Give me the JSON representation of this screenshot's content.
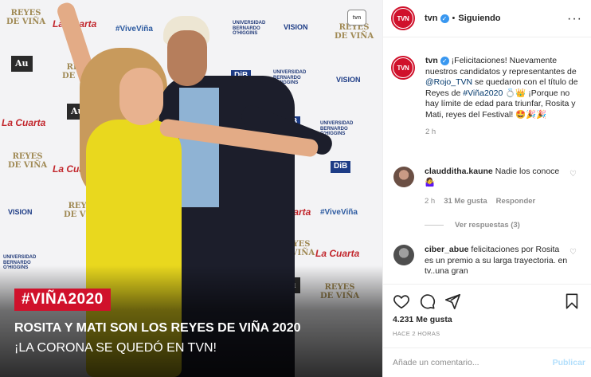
{
  "photo": {
    "hashtag": "#VIÑA2020",
    "headline": "ROSITA Y MATI SON LOS REYES DE VIÑA 2020",
    "subheadline": "¡LA CORONA SE QUEDÓ EN TVN!",
    "watermark": "tvn",
    "backdrop_logos": {
      "reyes": "REYES\nDE VIÑA",
      "cuarta": "La Cuarta",
      "vina": "#ViveViña",
      "vision": "VISION",
      "ubo": "UNIVERSIDAD\nBERNARDO\nO'HIGGINS",
      "dib": "DiB",
      "au": "Au"
    }
  },
  "header": {
    "avatar_text": "TVN",
    "username": "tvn",
    "separator": "•",
    "follow_label": "Siguiendo",
    "more_icon": "more-horizontal-icon"
  },
  "caption": {
    "username": "tvn",
    "text_1": " ¡Felicitaciones! Nuevamente nuestros candidatos y representantes de ",
    "mention": "@Rojo_TVN",
    "text_2": " se quedaron con el título de Reyes de ",
    "hashtag": "#Viña2020",
    "text_3": " 💍👑 ¡Porque no hay límite de edad para triunfar, Rosita y Mati, reyes del Festival! 🤩🎉🎉",
    "time": "2 h"
  },
  "comments": [
    {
      "username": "claudditha.kaune",
      "text": " Nadie los conoce 🤷‍♀️",
      "time": "2 h",
      "likes": "31 Me gusta",
      "reply_label": "Responder",
      "view_replies": "Ver respuestas (3)"
    },
    {
      "username": "ciber_abue",
      "text": " felicitaciones por Rosita es un premio a su larga trayectoria. en tv..una gran"
    }
  ],
  "actions": {
    "like_icon": "heart-icon",
    "comment_icon": "comment-icon",
    "share_icon": "share-icon",
    "save_icon": "bookmark-icon",
    "likes_text": "4.231 Me gusta",
    "posted_time": "HACE 2 HORAS"
  },
  "add_comment": {
    "placeholder": "Añade un comentario...",
    "publish_label": "Publicar"
  },
  "colors": {
    "brand_red": "#d0112b",
    "link": "#00376b",
    "muted": "#8e8e8e",
    "publish_disabled": "#b2dffc"
  }
}
